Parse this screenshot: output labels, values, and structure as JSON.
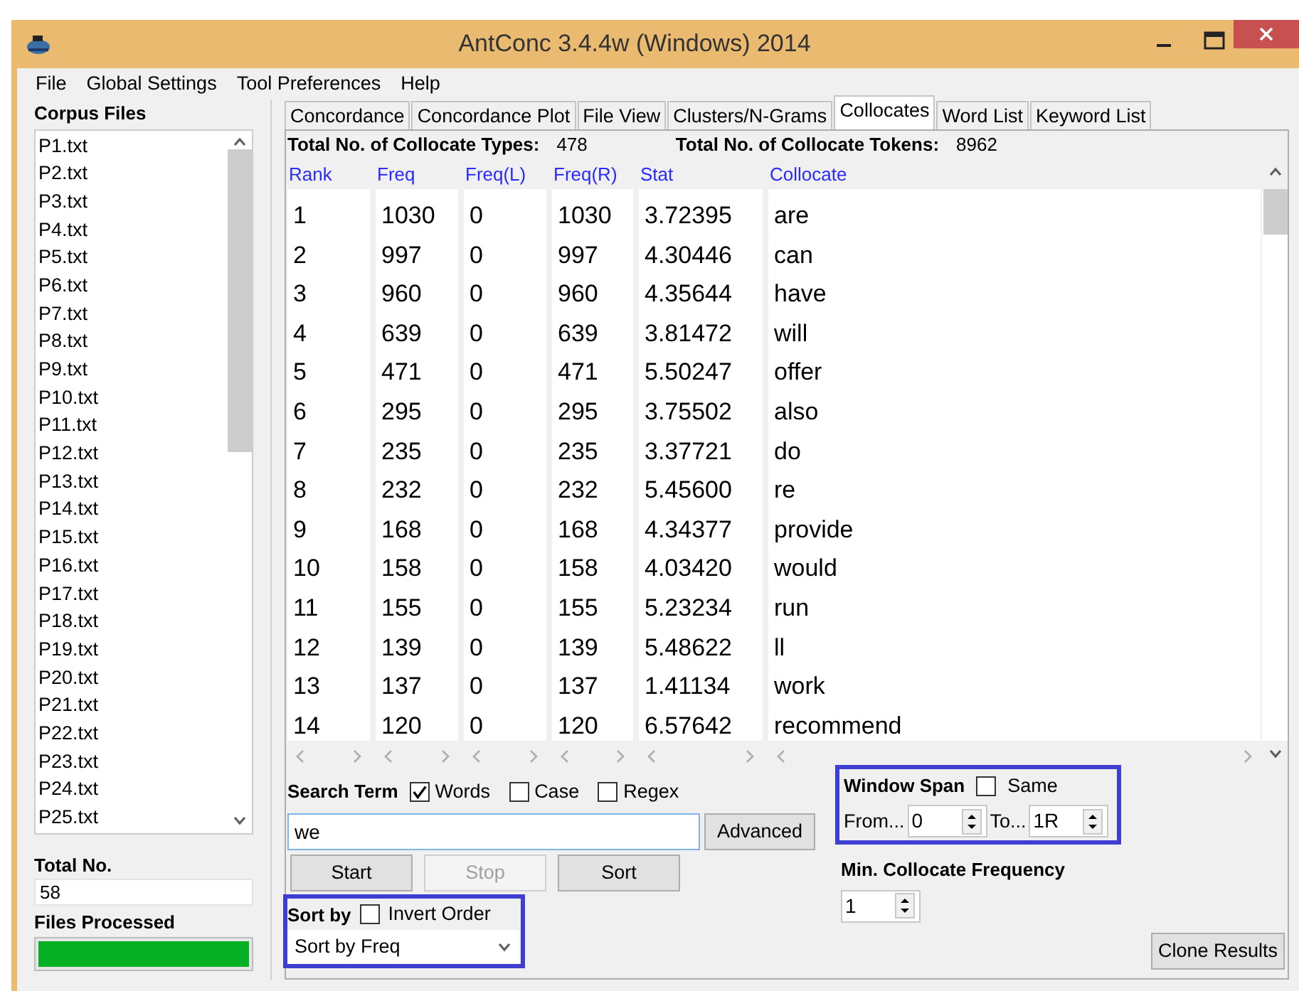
{
  "window": {
    "title": "AntConc 3.4.4w (Windows) 2014"
  },
  "menu": [
    "File",
    "Global Settings",
    "Tool Preferences",
    "Help"
  ],
  "sidebar": {
    "label": "Corpus Files",
    "files": [
      "P1.txt",
      "P2.txt",
      "P3.txt",
      "P4.txt",
      "P5.txt",
      "P6.txt",
      "P7.txt",
      "P8.txt",
      "P9.txt",
      "P10.txt",
      "P11.txt",
      "P12.txt",
      "P13.txt",
      "P14.txt",
      "P15.txt",
      "P16.txt",
      "P17.txt",
      "P18.txt",
      "P19.txt",
      "P20.txt",
      "P21.txt",
      "P22.txt",
      "P23.txt",
      "P24.txt",
      "P25.txt"
    ],
    "total_label": "Total No.",
    "total_value": "58",
    "processed_label": "Files Processed",
    "progress": {
      "level": 1
    }
  },
  "tabs": [
    {
      "label": "Concordance",
      "selected": false
    },
    {
      "label": "Concordance Plot",
      "selected": false
    },
    {
      "label": "File View",
      "selected": false
    },
    {
      "label": "Clusters/N-Grams",
      "selected": false
    },
    {
      "label": "Collocates",
      "selected": true
    },
    {
      "label": "Word List",
      "selected": false
    },
    {
      "label": "Keyword List",
      "selected": false
    }
  ],
  "totals": [
    {
      "label": "Total No. of Collocate Types:",
      "value": "478"
    },
    {
      "label": "Total No. of Collocate Tokens:",
      "value": "8962"
    }
  ],
  "table": {
    "columns": [
      "Rank",
      "Freq",
      "Freq(L)",
      "Freq(R)",
      "Stat",
      "Collocate"
    ],
    "rows": [
      [
        "1",
        "1030",
        "0",
        "1030",
        "3.72395",
        "are"
      ],
      [
        "2",
        "997",
        "0",
        "997",
        "4.30446",
        "can"
      ],
      [
        "3",
        "960",
        "0",
        "960",
        "4.35644",
        "have"
      ],
      [
        "4",
        "639",
        "0",
        "639",
        "3.81472",
        "will"
      ],
      [
        "5",
        "471",
        "0",
        "471",
        "5.50247",
        "offer"
      ],
      [
        "6",
        "295",
        "0",
        "295",
        "3.75502",
        "also"
      ],
      [
        "7",
        "235",
        "0",
        "235",
        "3.37721",
        "do"
      ],
      [
        "8",
        "232",
        "0",
        "232",
        "5.45600",
        "re"
      ],
      [
        "9",
        "168",
        "0",
        "168",
        "4.34377",
        "provide"
      ],
      [
        "10",
        "158",
        "0",
        "158",
        "4.03420",
        "would"
      ],
      [
        "11",
        "155",
        "0",
        "155",
        "5.23234",
        "run"
      ],
      [
        "12",
        "139",
        "0",
        "139",
        "5.48622",
        "ll"
      ],
      [
        "13",
        "137",
        "0",
        "137",
        "1.41134",
        "work"
      ],
      [
        "14",
        "120",
        "0",
        "120",
        "6.57642",
        "recommend"
      ]
    ]
  },
  "search": {
    "label": "Search Term",
    "options": [
      {
        "label": "Words",
        "checked": true
      },
      {
        "label": "Case",
        "checked": false
      },
      {
        "label": "Regex",
        "checked": false
      }
    ],
    "value": "we",
    "advanced": "Advanced"
  },
  "buttons": [
    {
      "label": "Start",
      "disabled": false
    },
    {
      "label": "Stop",
      "disabled": true
    },
    {
      "label": "Sort",
      "disabled": false
    }
  ],
  "sort": {
    "label": "Sort by",
    "invert": {
      "label": "Invert Order",
      "checked": false
    },
    "value": "Sort by Freq"
  },
  "window_span": {
    "label": "Window Span",
    "same": {
      "label": "Same",
      "checked": false
    },
    "from_label": "From...",
    "from_value": "0",
    "to_label": "To...",
    "to_value": "1R"
  },
  "min_freq": {
    "label": "Min. Collocate Frequency",
    "value": "1"
  },
  "clone": "Clone Results"
}
